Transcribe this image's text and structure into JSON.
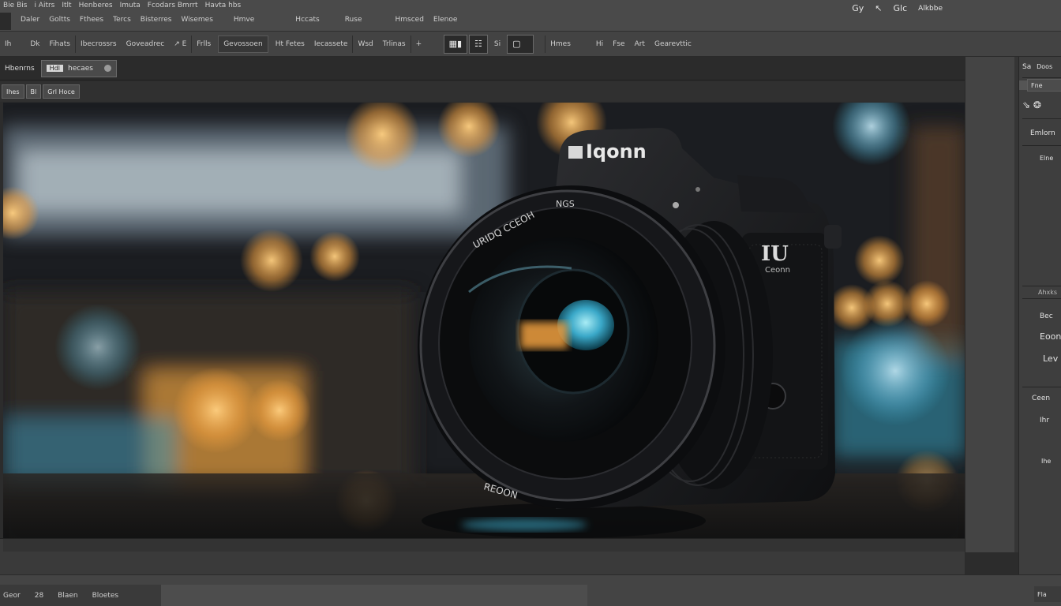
{
  "menubar": {
    "items": [
      "Bie Bis",
      "i Aitrs",
      "Itlt",
      "Henberes",
      "Imuta",
      "Fcodars Bmrrt",
      "Havta hbs"
    ],
    "subitems": [
      "Daler",
      "Goltts",
      "Fthees",
      "Tercs",
      "Bisterres",
      "Wisemes",
      "Hmve",
      "Hccats"
    ],
    "subitems2": [
      "Ruse",
      "Hmsced",
      "Elenoe"
    ],
    "right": [
      "Gy",
      "↖",
      "Glc",
      "Alkbbe"
    ]
  },
  "optbar": {
    "items": [
      "Ih",
      "Dk",
      "Fihats",
      "Ibecrossrs",
      "Goveadrec",
      "↗ E",
      "Frlls",
      "Gevossoen",
      "Ht Fetes",
      "Iecassete",
      "Wsd",
      "Trlinas",
      "∔",
      "Si",
      "Hmes",
      "Hi",
      "Fse",
      "Art",
      "Gearevttic"
    ]
  },
  "document": {
    "tab_label": "Hbenrns",
    "tab_tag": "Hdl",
    "tab_subtitle": "hecaes",
    "subtabs": [
      "Ihes",
      "Bl",
      "Grl Hoce"
    ]
  },
  "photo": {
    "body_brand": "Iqonn",
    "lens_text_top": "URIDQ CCEOH",
    "lens_text_right": "NGS",
    "lens_text_bottom": "REOON",
    "side_badge": "IU",
    "side_badge_sub": "Ceonn"
  },
  "panel": {
    "tab_label": "Sa",
    "tab_label2": "Doos",
    "button1": "Fne",
    "heading": "Emlorn",
    "row1": "Elne",
    "section": "Ahxks",
    "row2": "Bec",
    "row3": "Eoon",
    "row4": "Lev",
    "row5": "Ceen",
    "row6": "Ihr",
    "row7": "Ihe"
  },
  "status": {
    "items": [
      "Geor",
      "28",
      "Blaen",
      "Bloetes"
    ],
    "right": "Fla"
  },
  "colors": {
    "chrome": "#4a4a4a",
    "canvas_bg": "#1a1b1d",
    "accent_orange": "#f0a040",
    "accent_teal": "#3aa8c8"
  }
}
